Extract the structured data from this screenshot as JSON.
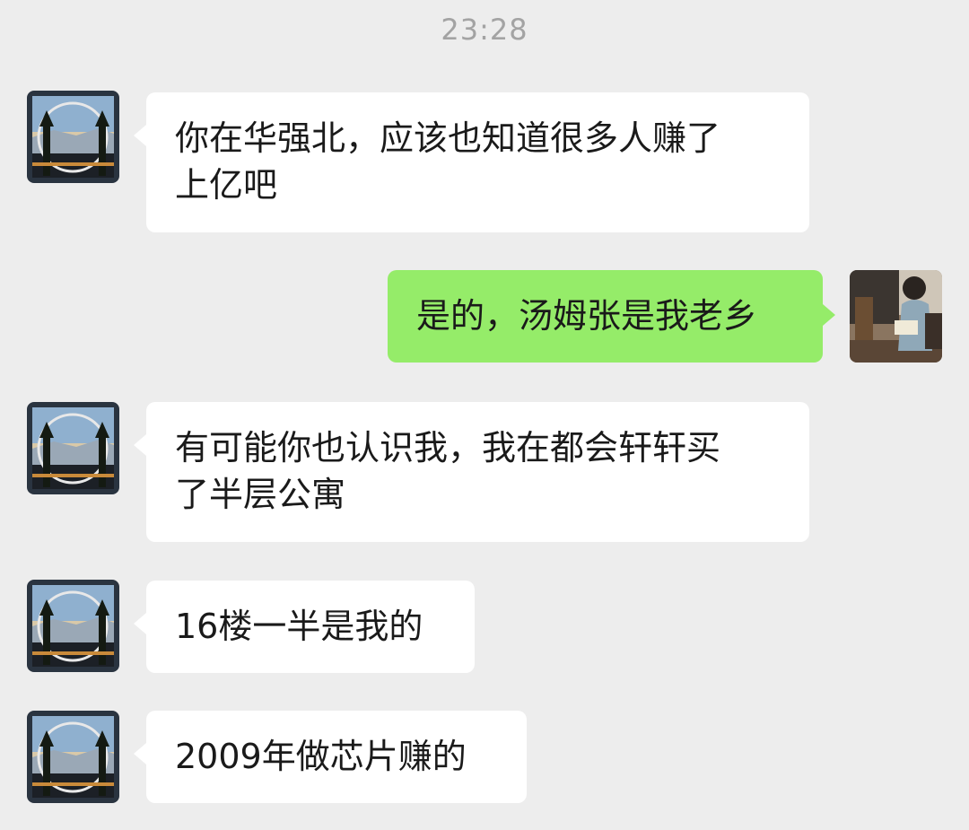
{
  "chat": {
    "timestamp": "23:28",
    "messages": [
      {
        "sender": "other",
        "text": "你在华强北，应该也知道很多人赚了\n上亿吧"
      },
      {
        "sender": "self",
        "text": "是的，汤姆张是我老乡"
      },
      {
        "sender": "other",
        "text": "有可能你也认识我，我在都会轩轩买\n了半层公寓"
      },
      {
        "sender": "other",
        "text": "16楼一半是我的"
      },
      {
        "sender": "other",
        "text": "2009年做芯片赚的"
      }
    ]
  },
  "colors": {
    "background": "#ededed",
    "incoming_bubble": "#ffffff",
    "outgoing_bubble": "#95ec69",
    "timestamp_text": "#a3a3a3"
  }
}
